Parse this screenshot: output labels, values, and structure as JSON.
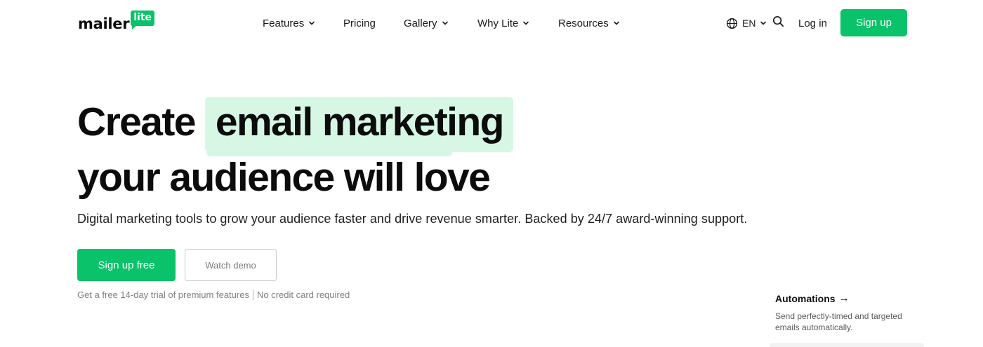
{
  "brand": {
    "logo_word": "mailer",
    "logo_badge": "lite",
    "accent_color": "#09c269",
    "highlight_color": "#d7f7e5"
  },
  "nav": {
    "items": [
      {
        "label": "Features",
        "has_dropdown": true
      },
      {
        "label": "Pricing",
        "has_dropdown": false
      },
      {
        "label": "Gallery",
        "has_dropdown": true
      },
      {
        "label": "Why Lite",
        "has_dropdown": true
      },
      {
        "label": "Resources",
        "has_dropdown": true
      }
    ]
  },
  "header": {
    "language": "EN",
    "login_label": "Log in",
    "signup_label": "Sign up",
    "icons": [
      "globe-icon",
      "chevron-down-icon",
      "search-icon"
    ]
  },
  "hero": {
    "title_create": "Create",
    "title_highlight": "email marketing",
    "title_line2": "your audience will love",
    "subtitle": "Digital marketing tools to grow your audience faster and drive revenue smarter. Backed by 24/7 award-winning support.",
    "cta_primary": "Sign up free",
    "cta_secondary": "Watch demo",
    "note_part1": "Get a free 14-day trial of premium features",
    "note_part2": "No credit card required"
  },
  "feature_card": {
    "title": "Automations",
    "arrow": "→",
    "description": "Send perfectly-timed and targeted emails automatically."
  }
}
